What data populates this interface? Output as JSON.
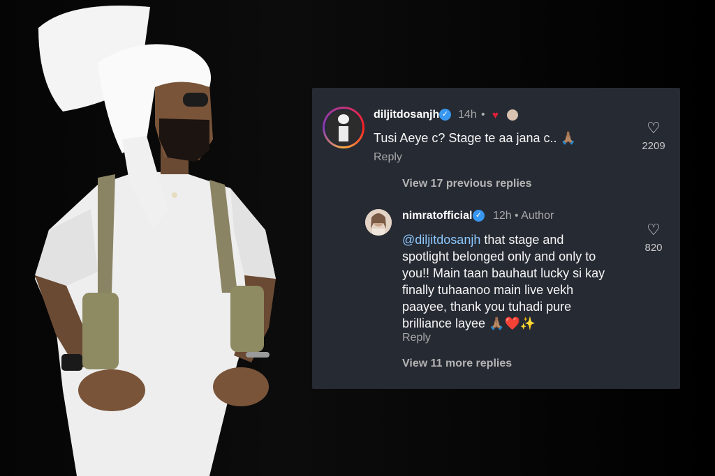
{
  "comment": {
    "username": "diljitdosanjh",
    "time": "14h",
    "separator": "•",
    "text": "Tusi Aeye c? Stage te aa jana c.. 🙏🏽",
    "reply_label": "Reply",
    "likes": "2209",
    "view_previous": "View 17 previous replies"
  },
  "reply": {
    "username": "nimratofficial",
    "time": "12h",
    "author_label": "• Author",
    "mention": "@diljitdosanjh",
    "line1": " that stage and",
    "line2": "spotlight belonged only and only to",
    "line3": "you!! Main taan bauhaut lucky si kay",
    "line4": "finally tuhaanoo main live vekh",
    "line5": "paayee, thank you tuhadi pure",
    "line6": "brilliance layee 🙏🏽❤️✨",
    "reply_label": "Reply",
    "likes": "820",
    "view_more": "View 11 more replies"
  },
  "icons": {
    "verified": "verified-badge-icon",
    "like": "heart-outline-icon",
    "liked_by_author": "red-heart-icon"
  },
  "colors": {
    "card_bg": "#262a33",
    "verified": "#3897f0",
    "mention": "#8cc8ff",
    "heart": "#e0203a"
  }
}
